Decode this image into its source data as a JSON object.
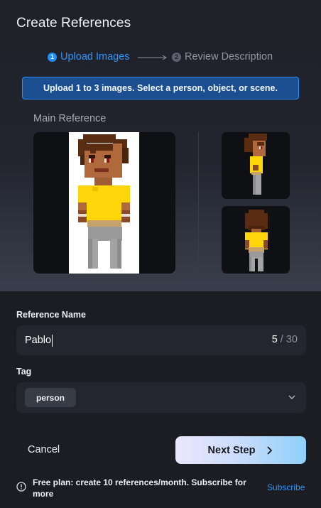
{
  "dialog": {
    "title": "Create References"
  },
  "steps": [
    {
      "number": "1",
      "label": "Upload Images",
      "active": true
    },
    {
      "number": "2",
      "label": "Review Description",
      "active": false
    }
  ],
  "banner": {
    "text": "Upload 1 to 3 images. Select a person, object, or scene."
  },
  "images": {
    "main_label": "Main Reference",
    "main_icon": "pixel-character-front",
    "thumbs": [
      "pixel-character-side",
      "pixel-character-back"
    ]
  },
  "form": {
    "name_label": "Reference Name",
    "name_value": "Pablo",
    "name_count": "5",
    "name_max": "30",
    "tag_label": "Tag",
    "tag_value": "person"
  },
  "actions": {
    "cancel": "Cancel",
    "next": "Next Step"
  },
  "footer": {
    "plan_text": "Free plan: create 10 references/month. Subscribe for more",
    "subscribe": "Subscribe"
  },
  "colors": {
    "accent": "#2c95ff",
    "banner_bg": "#1b4f91",
    "background": "#1b1d23",
    "shirt": "#ffd60a"
  }
}
